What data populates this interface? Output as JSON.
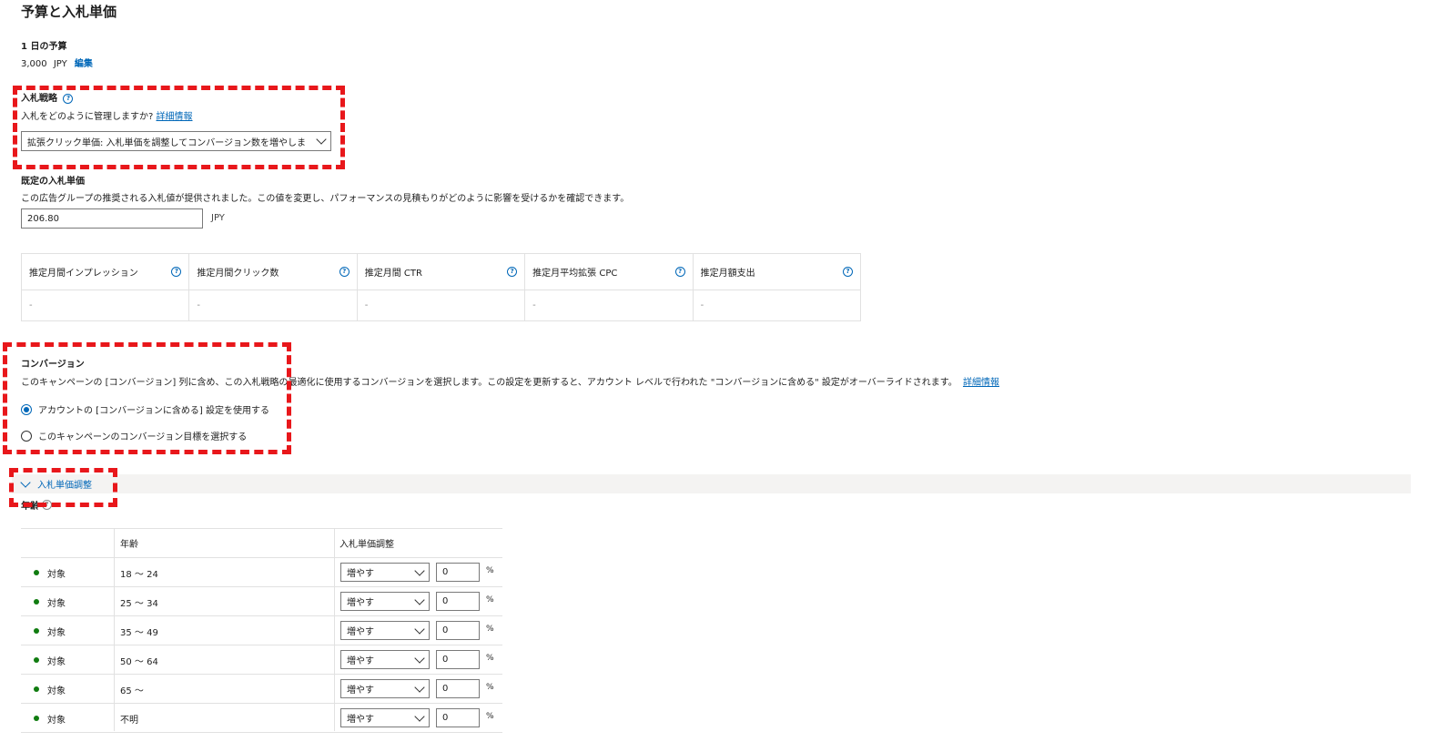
{
  "page_title": "予算と入札単価",
  "budget": {
    "label": "1 日の予算",
    "amount": "3,000",
    "currency": "JPY",
    "edit_link": "編集"
  },
  "bid_strategy": {
    "label": "入札戦略",
    "question": "入札をどのように管理しますか?",
    "learn_more": "詳細情報",
    "selected": "拡張クリック単価: 入札単価を調整してコンバージョン数を増やしま"
  },
  "default_bid": {
    "label": "既定の入札単価",
    "description": "この広告グループの推奨される入札値が提供されました。この値を変更し、パフォーマンスの見積もりがどのように影響を受けるかを確認できます。",
    "value": "206.80",
    "currency": "JPY"
  },
  "estimates": {
    "headers": [
      "推定月間インプレッション",
      "推定月間クリック数",
      "推定月間 CTR",
      "推定月平均拡張 CPC",
      "推定月額支出"
    ],
    "values": [
      "-",
      "-",
      "-",
      "-",
      "-"
    ]
  },
  "conversions": {
    "label": "コンバージョン",
    "description": "このキャンペーンの [コンバージョン] 列に含め、この入札戦略の最適化に使用するコンバージョンを選択します。この設定を更新すると、アカウント レベルで行われた \"コンバージョンに含める\" 設定がオーバーライドされます。",
    "learn_more": "詳細情報",
    "option_account": "アカウントの [コンバージョンに含める] 設定を使用する",
    "option_campaign": "このキャンペーンのコンバージョン目標を選択する"
  },
  "bid_adjustments": {
    "toggle_label": "入札単価調整",
    "age_label": "年齢",
    "column_age": "年齢",
    "column_adjustment": "入札単価調整",
    "rows": [
      {
        "status": "対象",
        "age": "18 〜 24",
        "direction": "増やす",
        "value": "0",
        "unit": "%"
      },
      {
        "status": "対象",
        "age": "25 〜 34",
        "direction": "増やす",
        "value": "0",
        "unit": "%"
      },
      {
        "status": "対象",
        "age": "35 〜 49",
        "direction": "増やす",
        "value": "0",
        "unit": "%"
      },
      {
        "status": "対象",
        "age": "50 〜 64",
        "direction": "増やす",
        "value": "0",
        "unit": "%"
      },
      {
        "status": "対象",
        "age": "65 〜",
        "direction": "増やす",
        "value": "0",
        "unit": "%"
      },
      {
        "status": "対象",
        "age": "不明",
        "direction": "増やす",
        "value": "0",
        "unit": "%"
      }
    ]
  },
  "colors": {
    "accent": "#0067b8",
    "highlight": "#e8171b",
    "status": "#107c10"
  },
  "icons": {
    "help": "question-circle-icon",
    "dropdown": "chevron-down-icon"
  }
}
